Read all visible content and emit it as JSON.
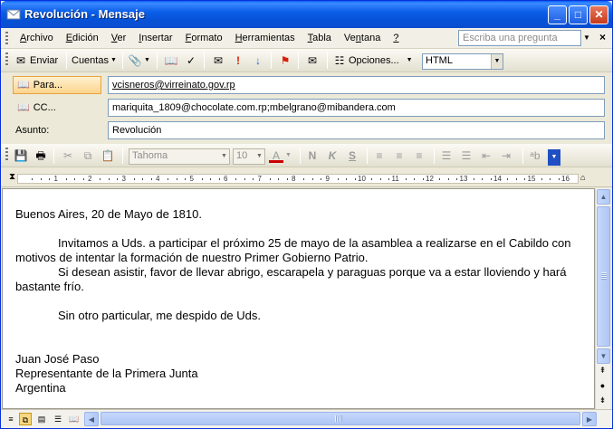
{
  "window": {
    "title": "Revolución - Mensaje",
    "controls": {
      "minimize": "_",
      "maximize": "□",
      "close": "✕"
    }
  },
  "menubar": {
    "items": [
      {
        "label": "Archivo",
        "key": "A"
      },
      {
        "label": "Edición",
        "key": "E"
      },
      {
        "label": "Ver",
        "key": "V"
      },
      {
        "label": "Insertar",
        "key": "I"
      },
      {
        "label": "Formato",
        "key": "F"
      },
      {
        "label": "Herramientas",
        "key": "H"
      },
      {
        "label": "Tabla",
        "key": "T"
      },
      {
        "label": "Ventana",
        "key": "n"
      },
      {
        "label": "?",
        "key": "?"
      }
    ],
    "ask_placeholder": "Escriba una pregunta",
    "close_doc": "×"
  },
  "toolbar": {
    "send_label": "Enviar",
    "accounts_label": "Cuentas",
    "options_label": "Opciones...",
    "format_value": "HTML"
  },
  "headers": {
    "to_label": "Para...",
    "to_value": "vcisneros@virreinato.gov.rp",
    "cc_label": "CC...",
    "cc_value": "mariquita_1809@chocolate.com.rp;mbelgrano@mibandera.com",
    "subject_label": "Asunto:",
    "subject_value": "Revolución"
  },
  "formatting": {
    "font_name": "Tahoma",
    "font_size": "10"
  },
  "ruler": {
    "numbers": [
      "1",
      "2",
      "3",
      "4",
      "5",
      "6",
      "7",
      "8",
      "9",
      "10",
      "11",
      "12",
      "13",
      "14",
      "15",
      "16"
    ]
  },
  "body": {
    "date_line": "Buenos Aires, 20 de Mayo de 1810.",
    "para1": "Invitamos a Uds. a participar el próximo 25 de mayo de la asamblea a realizarse en el Cabildo con motivos de intentar la formación de nuestro Primer Gobierno Patrio.",
    "para2": "Si desean asistir, favor de llevar abrigo, escarapela y paraguas porque va a estar lloviendo y hará bastante frío.",
    "closing": "Sin otro particular, me despido de Uds.",
    "sig_name": "Juan José Paso",
    "sig_title": "Representante de la Primera Junta",
    "sig_country": "Argentina"
  }
}
